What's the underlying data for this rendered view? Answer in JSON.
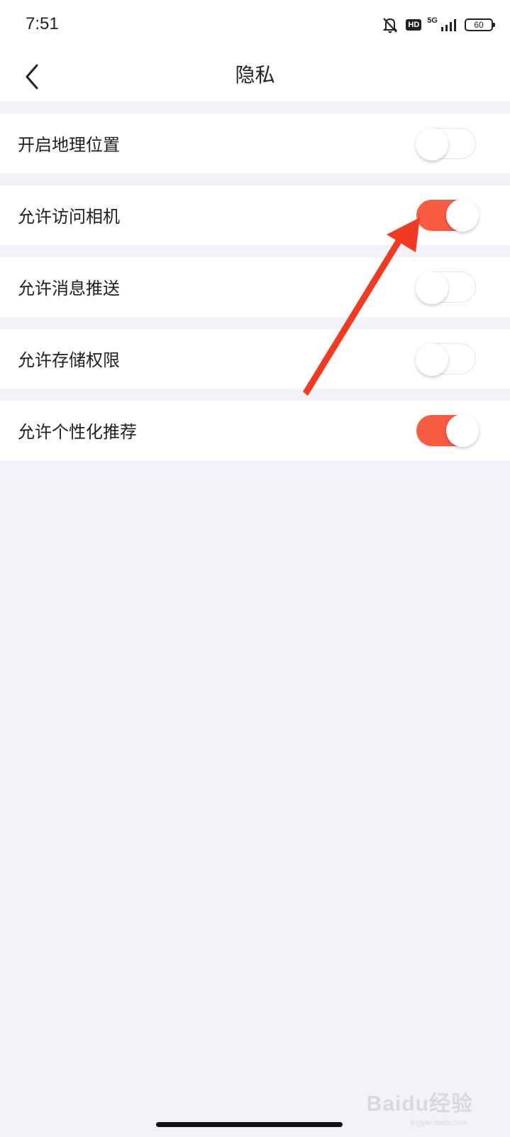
{
  "status_bar": {
    "time": "7:51",
    "hd": "HD",
    "network": "5G",
    "battery": "60"
  },
  "header": {
    "title": "隐私",
    "back_icon": "chevron-left-icon"
  },
  "settings": [
    {
      "label": "开启地理位置",
      "enabled": false
    },
    {
      "label": "允许访问相机",
      "enabled": true
    },
    {
      "label": "允许消息推送",
      "enabled": false
    },
    {
      "label": "允许存储权限",
      "enabled": false
    },
    {
      "label": "允许个性化推荐",
      "enabled": true
    }
  ],
  "colors": {
    "accent": "#fa5b43",
    "annotation_arrow": "#f23a22",
    "page_background": "#f2f3f8"
  },
  "watermark": {
    "brand": "Baidu经验",
    "url": "jingyan.baidu.com"
  }
}
